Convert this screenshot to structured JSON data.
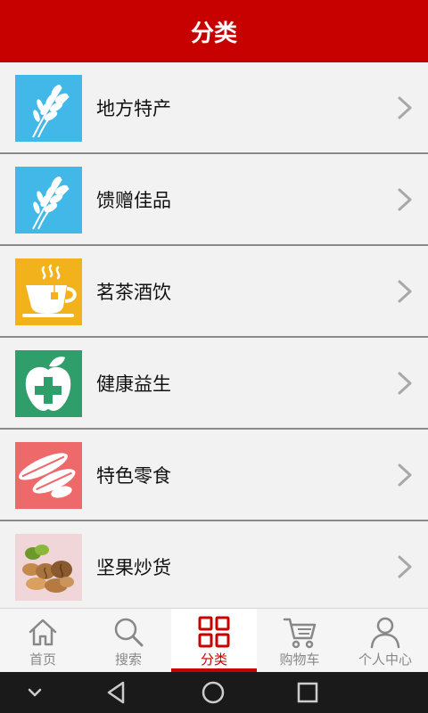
{
  "header": {
    "title": "分类"
  },
  "categories": [
    {
      "label": "地方特产",
      "icon": "wheat-icon",
      "bg": "#42b8e8"
    },
    {
      "label": "馈赠佳品",
      "icon": "wheat-icon",
      "bg": "#42b8e8"
    },
    {
      "label": "茗茶酒饮",
      "icon": "teacup-icon",
      "bg": "#f2b21c"
    },
    {
      "label": "健康益生",
      "icon": "apple-cross-icon",
      "bg": "#2f9e6a"
    },
    {
      "label": "特色零食",
      "icon": "seeds-icon",
      "bg": "#ee6a6a"
    },
    {
      "label": "坚果炒货",
      "icon": "nuts-photo",
      "bg": "#f0d6d8"
    }
  ],
  "tabbar": {
    "active_color": "#c70000",
    "items": [
      {
        "label": "首页",
        "icon": "home-icon"
      },
      {
        "label": "搜索",
        "icon": "search-icon"
      },
      {
        "label": "分类",
        "icon": "category-grid-icon",
        "active": true
      },
      {
        "label": "购物车",
        "icon": "cart-icon"
      },
      {
        "label": "个人中心",
        "icon": "user-icon"
      }
    ]
  },
  "system_bar": {
    "buttons": [
      "collapse-icon",
      "back-icon",
      "home-circle-icon",
      "recents-icon"
    ]
  }
}
